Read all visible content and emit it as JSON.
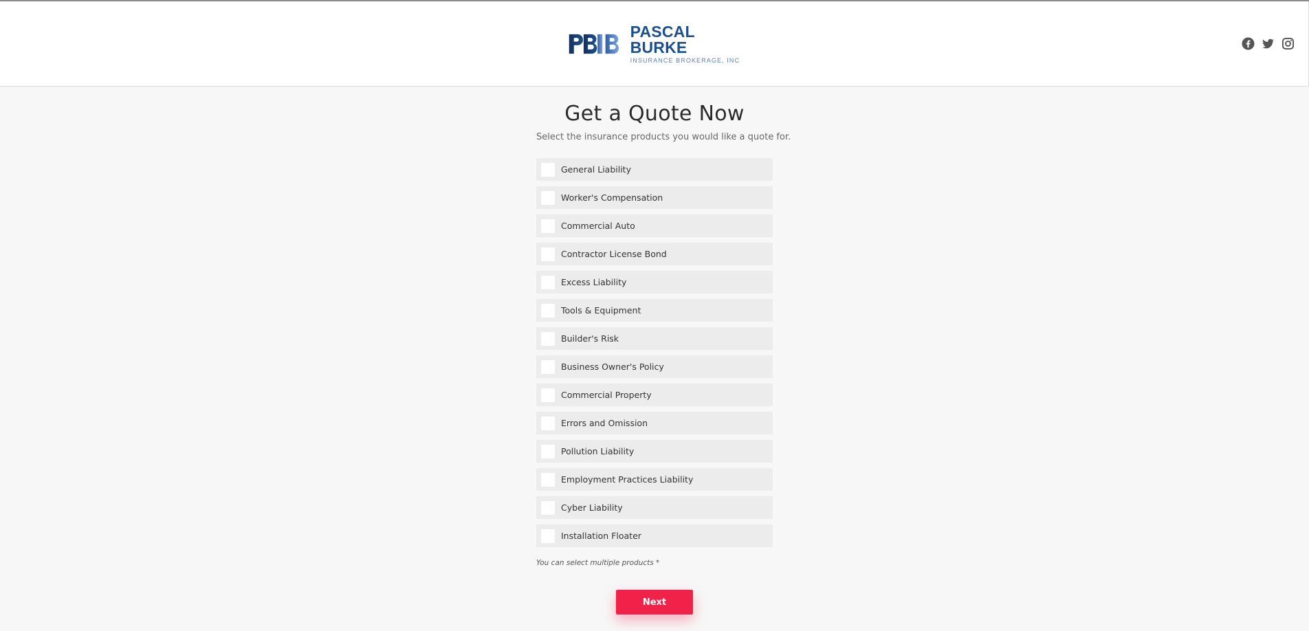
{
  "header": {
    "logo": {
      "initials": "PBIB",
      "name": "PASCAL BURKE",
      "tagline": "INSURANCE BROKERAGE, INC"
    },
    "social_icons": [
      "facebook-icon",
      "twitter-icon",
      "instagram-icon"
    ]
  },
  "main": {
    "title": "Get a Quote Now",
    "subtitle": "Select the insurance products you would like a quote for.",
    "options": [
      {
        "label": "General Liability",
        "checked": false
      },
      {
        "label": "Worker's Compensation",
        "checked": false
      },
      {
        "label": "Commercial Auto",
        "checked": false
      },
      {
        "label": "Contractor License Bond",
        "checked": false
      },
      {
        "label": "Excess Liability",
        "checked": false
      },
      {
        "label": "Tools & Equipment",
        "checked": false
      },
      {
        "label": "Builder's Risk",
        "checked": false
      },
      {
        "label": "Business Owner's Policy",
        "checked": false
      },
      {
        "label": "Commercial Property",
        "checked": false
      },
      {
        "label": "Errors and Omission",
        "checked": false
      },
      {
        "label": "Pollution Liability",
        "checked": false
      },
      {
        "label": "Employment Practices Liability",
        "checked": false
      },
      {
        "label": "Cyber Liability",
        "checked": false
      },
      {
        "label": "Installation Floater",
        "checked": false
      }
    ],
    "hint": "You can select multiple products *",
    "next_label": "Next"
  },
  "colors": {
    "accent": "#f0224a",
    "brand_blue": "#1d4f8c",
    "background": "#f7f7f7",
    "option_bg": "#ececec"
  }
}
